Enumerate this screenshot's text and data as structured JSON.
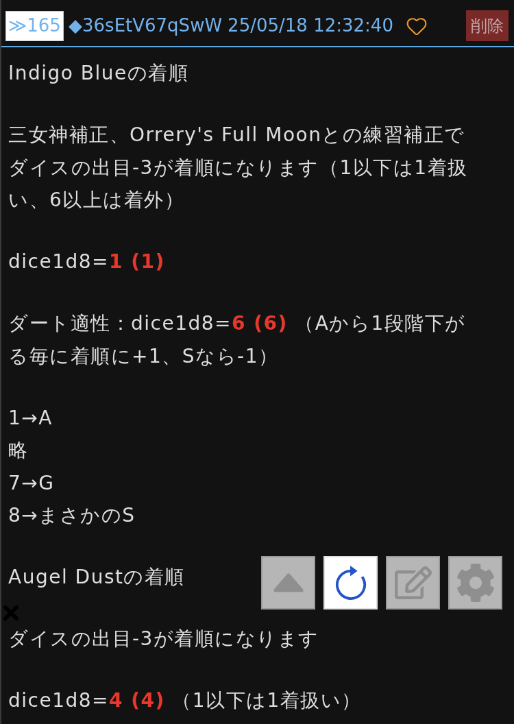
{
  "post_header": {
    "number": "≫165",
    "id": "◆36sEtV67qSwW",
    "datetime": "25/05/18 12:32:40",
    "delete_button": "削除"
  },
  "body": [
    {
      "kind": "text",
      "text": "Indigo Blueの着順"
    },
    {
      "kind": "text",
      "text": "三女神補正、Orrery's Full Moonとの練習補正でダイスの出目-3が着順になります（1以下は1着扱い、6以上は着外）"
    },
    {
      "kind": "dice",
      "prefix": "dice1d8=",
      "result": "1 (1)"
    },
    {
      "kind": "dice",
      "prefix": "ダート適性：dice1d8=",
      "result": "6 (6)",
      "suffix": "（Aから1段階下がる毎に着順に+1、Sなら-1）"
    },
    {
      "kind": "list",
      "lines": [
        "1→A",
        "略",
        "7→G",
        "8→まさかのS"
      ]
    },
    {
      "kind": "text",
      "text": "Augel Dustの着順"
    },
    {
      "kind": "text",
      "text": "ダイスの出目-3が着順になります"
    },
    {
      "kind": "dice",
      "prefix": "dice1d8=",
      "result": "4 (4)",
      "suffix": "（1以下は1着扱い）"
    }
  ],
  "toolbar": {
    "buttons": [
      {
        "kind": "up",
        "disabled": true
      },
      {
        "kind": "reload",
        "disabled": false
      },
      {
        "kind": "edit",
        "disabled": true
      },
      {
        "kind": "settings",
        "disabled": true
      }
    ]
  }
}
